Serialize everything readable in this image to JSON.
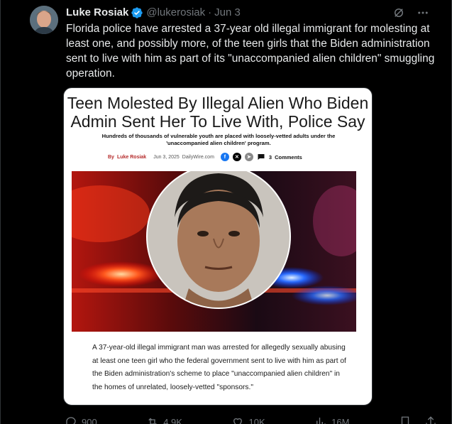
{
  "tweet": {
    "author_name": "Luke Rosiak",
    "handle": "@lukerosiak",
    "separator": "·",
    "date": "Jun 3",
    "text": "Florida police have arrested a 37-year old illegal immigrant for molesting at least one, and possibly more, of the teen girls that the Biden administration sent to live with him as part of its \"unaccompanied alien children\" smuggling operation."
  },
  "article": {
    "title": "Teen Molested By Illegal Alien Who Biden Admin Sent Her To Live With, Police Say",
    "subtitle": "Hundreds of thousands of vulnerable youth are placed with loosely-vetted adults under the 'unaccompanied alien children' program.",
    "by_label": "By",
    "author": "Luke Rosiak",
    "date": "Jun 3, 2025",
    "site": "DailyWire.com",
    "comments_count": "3",
    "comments_label": "Comments",
    "body": "A 37-year-old illegal immigrant man was arrested for allegedly sexually abusing at least one teen girl who the federal government sent to live with him as part of the Biden administration's scheme to place \"unaccompanied alien children\" in the homes of unrelated, loosely-vetted \"sponsors.\""
  },
  "actions": {
    "replies": "900",
    "reposts": "4.9K",
    "likes": "10K",
    "views": "16M"
  },
  "colors": {
    "background": "#000000",
    "verified": "#1d9bf0",
    "muted": "#71767b",
    "author_link": "#b52a2a"
  }
}
